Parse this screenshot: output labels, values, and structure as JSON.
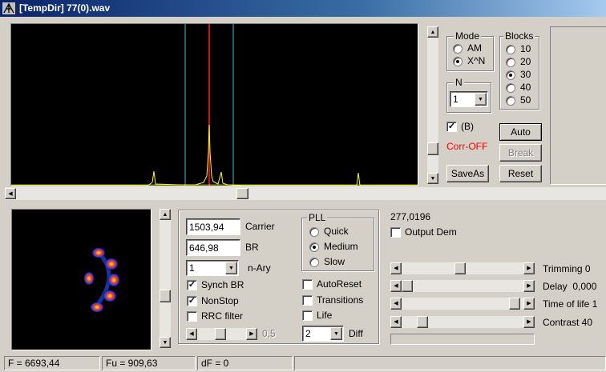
{
  "window": {
    "title": "[TempDir] 77(0).wav",
    "icon": "antenna-icon"
  },
  "spectrum": {
    "marker_colors": {
      "center": "#d01010",
      "bounds": "#40c0c8",
      "peaks": "#ffff00"
    }
  },
  "mode": {
    "title": "Mode",
    "options": [
      {
        "label": "AM",
        "selected": false
      },
      {
        "label": "X^N",
        "selected": true
      }
    ]
  },
  "n_select": {
    "title": "N",
    "value": "1"
  },
  "blocks": {
    "title": "Blocks",
    "options": [
      {
        "label": "10",
        "selected": false
      },
      {
        "label": "20",
        "selected": false
      },
      {
        "label": "30",
        "selected": true
      },
      {
        "label": "40",
        "selected": false
      },
      {
        "label": "50",
        "selected": false
      }
    ]
  },
  "b_check": {
    "label": "(B)",
    "checked": true
  },
  "corr_status": {
    "text": "Corr-OFF",
    "color": "#ff0000"
  },
  "buttons": {
    "auto": "Auto",
    "break": "Break",
    "save_as": "SaveAs",
    "reset": "Reset"
  },
  "params": {
    "carrier": {
      "value": "1503,94",
      "label": "Carrier"
    },
    "br": {
      "value": "646,98",
      "label": "BR"
    },
    "nary": {
      "value": "1",
      "label": "n-Ary"
    }
  },
  "checks_left": [
    {
      "label": "Synch BR",
      "checked": true
    },
    {
      "label": "NonStop",
      "checked": true
    },
    {
      "label": "RRC filter",
      "checked": false
    }
  ],
  "rolloff": {
    "value": "0,5"
  },
  "pll": {
    "title": "PLL",
    "options": [
      {
        "label": "Quick",
        "selected": false
      },
      {
        "label": "Medium",
        "selected": true
      },
      {
        "label": "Slow",
        "selected": false
      }
    ]
  },
  "checks_mid": [
    {
      "label": "AutoReset",
      "checked": false
    },
    {
      "label": "Transitions",
      "checked": false
    },
    {
      "label": "Life",
      "checked": false
    }
  ],
  "diff": {
    "value": "2",
    "label": "Diff"
  },
  "output": {
    "value": "277,0196",
    "dem_label": "Output Dem",
    "dem_checked": false
  },
  "sliders": [
    {
      "label": "Trimming 0",
      "level": 0.48
    },
    {
      "label": "Delay  0,000",
      "level": 0.0
    },
    {
      "label": "Time of life 1",
      "level": 0.97
    },
    {
      "label": "Contrast 40",
      "level": 0.14
    }
  ],
  "status": {
    "f": "F = 6693,44",
    "fu": "Fu = 909,63",
    "df": "dF = 0"
  }
}
